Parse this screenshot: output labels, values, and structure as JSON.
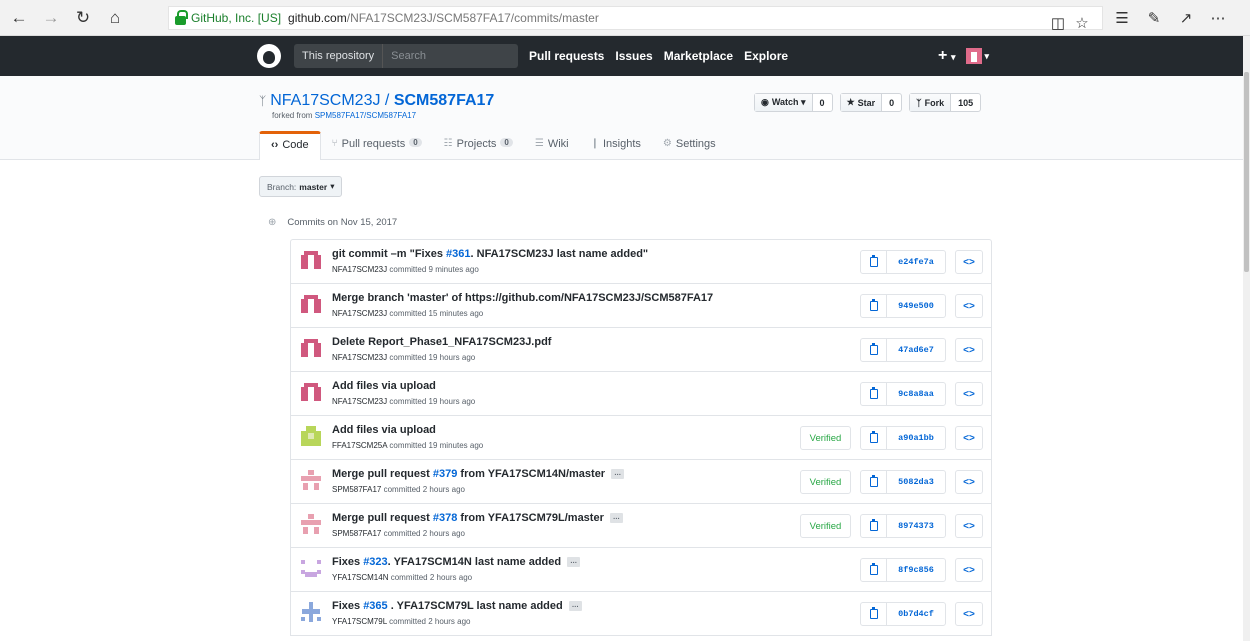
{
  "browser": {
    "cert_label": "GitHub, Inc. [US]",
    "url_host": "github.com",
    "url_path": "/NFA17SCM23J/SCM587FA17/commits/master"
  },
  "header": {
    "scope_label": "This repository",
    "search_placeholder": "Search",
    "nav": [
      "Pull requests",
      "Issues",
      "Marketplace",
      "Explore"
    ],
    "plus": "+",
    "caret": "▾"
  },
  "repo": {
    "owner": "NFA17SCM23J",
    "separator": "/",
    "name": "SCM587FA17",
    "forked_prefix": "forked from ",
    "forked_from": "SPM587FA17/SCM587FA17",
    "watch_label": "Watch ▾",
    "watch_count": "0",
    "star_label": "Star",
    "star_count": "0",
    "fork_label": "Fork",
    "fork_count": "105"
  },
  "tabs": [
    {
      "label": "Code",
      "icon": "‹›"
    },
    {
      "label": "Pull requests",
      "icon": "⑂",
      "count": "0"
    },
    {
      "label": "Projects",
      "icon": "☷",
      "count": "0"
    },
    {
      "label": "Wiki",
      "icon": "☰"
    },
    {
      "label": "Insights",
      "icon": "❙"
    },
    {
      "label": "Settings",
      "icon": "⚙"
    }
  ],
  "branch": {
    "prefix": "Branch:",
    "name": "master",
    "caret": "▾"
  },
  "day_label": "Commits on Nov 15, 2017",
  "verified_label": "Verified",
  "browse_label": "<>",
  "ellipsis": "…",
  "committed_word": "committed",
  "commits": [
    {
      "msg_pre": "git commit –m \"Fixes ",
      "issue": "#361",
      "msg_post": ". NFA17SCM23J last name added\"",
      "author": "NFA17SCM23J",
      "time": "9 minutes ago",
      "sha": "e24fe7a",
      "verified": false,
      "ellipsis": false,
      "avatar": "red"
    },
    {
      "msg_pre": "Merge branch 'master' of https://github.com/NFA17SCM23J/SCM587FA17",
      "issue": "",
      "msg_post": "",
      "author": "NFA17SCM23J",
      "time": "15 minutes ago",
      "sha": "949e500",
      "verified": false,
      "ellipsis": false,
      "avatar": "red"
    },
    {
      "msg_pre": "Delete Report_Phase1_NFA17SCM23J.pdf",
      "issue": "",
      "msg_post": "",
      "author": "NFA17SCM23J",
      "time": "19 hours ago",
      "sha": "47ad6e7",
      "verified": false,
      "ellipsis": false,
      "avatar": "red"
    },
    {
      "msg_pre": "Add files via upload",
      "issue": "",
      "msg_post": "",
      "author": "NFA17SCM23J",
      "time": "19 hours ago",
      "sha": "9c8a8aa",
      "verified": false,
      "ellipsis": false,
      "avatar": "red"
    },
    {
      "msg_pre": "Add files via upload",
      "issue": "",
      "msg_post": "",
      "author": "FFA17SCM25A",
      "time": "19 minutes ago",
      "sha": "a90a1bb",
      "verified": true,
      "ellipsis": false,
      "avatar": "green"
    },
    {
      "msg_pre": "Merge pull request ",
      "issue": "#379",
      "msg_post": " from YFA17SCM14N/master",
      "author": "SPM587FA17",
      "time": "2 hours ago",
      "sha": "5082da3",
      "verified": true,
      "ellipsis": true,
      "avatar": "pink"
    },
    {
      "msg_pre": "Merge pull request ",
      "issue": "#378",
      "msg_post": " from YFA17SCM79L/master",
      "author": "SPM587FA17",
      "time": "2 hours ago",
      "sha": "8974373",
      "verified": true,
      "ellipsis": true,
      "avatar": "pink"
    },
    {
      "msg_pre": "Fixes ",
      "issue": "#323",
      "msg_post": ". YFA17SCM14N last name added",
      "author": "YFA17SCM14N",
      "time": "2 hours ago",
      "sha": "8f9c856",
      "verified": false,
      "ellipsis": true,
      "avatar": "purple"
    },
    {
      "msg_pre": "Fixes ",
      "issue": "#365",
      "msg_post": " . YFA17SCM79L last name added",
      "author": "YFA17SCM79L",
      "time": "2 hours ago",
      "sha": "0b7d4cf",
      "verified": false,
      "ellipsis": true,
      "avatar": "blue"
    }
  ],
  "colors": {
    "red": "#d0587e",
    "green": "#b8d65a",
    "pink": "#e8a0b0",
    "purple": "#c8a6e0",
    "blue": "#8ba8dc",
    "link": "#0366d6",
    "header_bg": "#24292e",
    "tab_accent": "#e36209",
    "verified": "#28a745"
  }
}
